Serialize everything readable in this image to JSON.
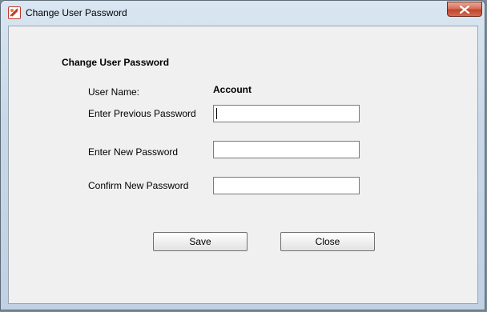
{
  "window": {
    "title": "Change User Password"
  },
  "form": {
    "heading": "Change User Password",
    "user_name_label": "User Name:",
    "user_name_value": "Account",
    "previous_password_label": "Enter Previous Password",
    "previous_password_value": "",
    "new_password_label": "Enter New Password",
    "new_password_value": "",
    "confirm_password_label": "Confirm New Password",
    "confirm_password_value": ""
  },
  "buttons": {
    "save_label": "Save",
    "close_label": "Close"
  },
  "icons": {
    "app": "app-icon",
    "close": "close-icon"
  },
  "colors": {
    "close_button": "#c0452d",
    "client_background": "#f0f0f0"
  }
}
